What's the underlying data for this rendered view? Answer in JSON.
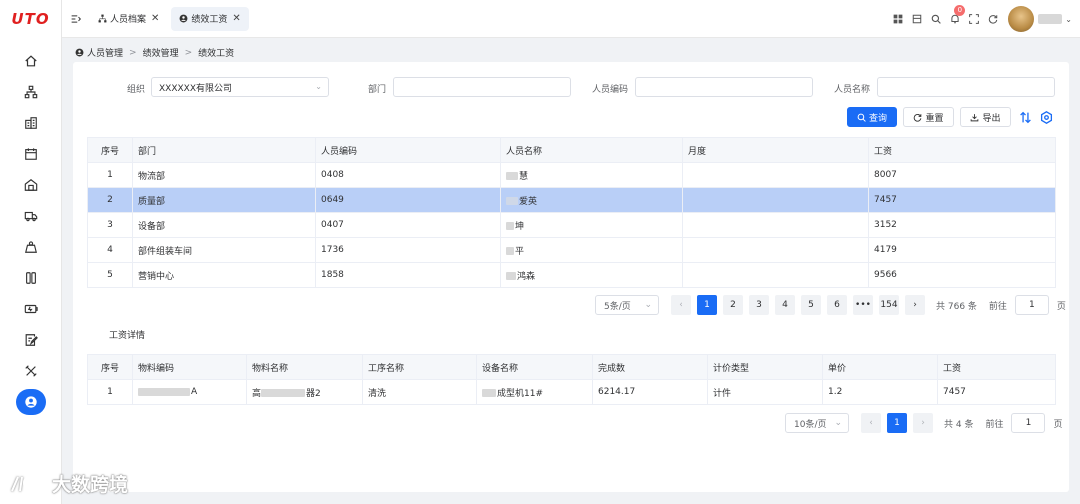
{
  "app": {
    "logo": "UTO"
  },
  "sidebar": {
    "items": [
      {
        "icon": "home-icon"
      },
      {
        "icon": "org-chart-icon"
      },
      {
        "icon": "building-icon"
      },
      {
        "icon": "calendar-icon"
      },
      {
        "icon": "warehouse-icon"
      },
      {
        "icon": "truck-icon"
      },
      {
        "icon": "weight-icon"
      },
      {
        "icon": "columns-icon"
      },
      {
        "icon": "battery-icon"
      },
      {
        "icon": "edit-doc-icon"
      },
      {
        "icon": "tools-icon"
      },
      {
        "icon": "user-circle-icon",
        "active": true
      }
    ],
    "active_color": "#1a6cf5"
  },
  "tabs": [
    {
      "label": "人员档案",
      "close": "✕"
    },
    {
      "label": "绩效工资",
      "close": "✕",
      "active": true
    }
  ],
  "header": {
    "notification_count": "0",
    "caret": "⌄"
  },
  "breadcrumb": [
    "人员管理",
    "绩效管理",
    "绩效工资"
  ],
  "breadcrumb_sep": ">",
  "filters": {
    "org_label": "组织",
    "org_value": "XXXXXX有限公司",
    "dept_label": "部门",
    "dept_value": "",
    "code_label": "人员编码",
    "code_value": "",
    "name_label": "人员名称",
    "name_value": ""
  },
  "actions": {
    "query": "查询",
    "reset": "重置",
    "export": "导出"
  },
  "main_table": {
    "columns": [
      "序号",
      "部门",
      "人员编码",
      "人员名称",
      "月度",
      "工资"
    ],
    "rows": [
      {
        "no": "1",
        "dept": "物流部",
        "code": "0408",
        "name": "慧",
        "month": "",
        "salary": "8007"
      },
      {
        "no": "2",
        "dept": "质量部",
        "code": "0649",
        "name": "爱英",
        "month": "",
        "salary": "7457",
        "selected": true
      },
      {
        "no": "3",
        "dept": "设备部",
        "code": "0407",
        "name": "坤",
        "month": "",
        "salary": "3152"
      },
      {
        "no": "4",
        "dept": "部件组装车间",
        "code": "1736",
        "name": "平",
        "month": "",
        "salary": "4179"
      },
      {
        "no": "5",
        "dept": "营销中心",
        "code": "1858",
        "name": "鸿森",
        "month": "",
        "salary": "9566"
      }
    ]
  },
  "pagination": {
    "page_size": "5条/页",
    "prev": "‹",
    "pages": [
      "1",
      "2",
      "3",
      "4",
      "5",
      "6",
      "•••",
      "154"
    ],
    "current": "1",
    "next": "›",
    "total": "共 766 条",
    "goto_label": "前往",
    "goto_value": "1",
    "page_unit": "页"
  },
  "detail": {
    "title": "工资详情",
    "columns": [
      "序号",
      "物料编码",
      "物料名称",
      "工序名称",
      "设备名称",
      "完成数",
      "计价类型",
      "单价",
      "工资"
    ],
    "rows": [
      {
        "no": "1",
        "material_code": "A",
        "material_name_prefix": "高",
        "material_name": "器2",
        "process": "清洗",
        "equipment": "成型机11#",
        "completed": "6214.17",
        "pricing": "计件",
        "unit_price": "1.2",
        "salary": "7457"
      }
    ]
  },
  "detail_pagination": {
    "page_size": "10条/页",
    "prev": "‹",
    "current": "1",
    "next": "›",
    "total": "共 4 条",
    "goto_label": "前往",
    "goto_value": "1",
    "page_unit": "页"
  },
  "watermark": {
    "text": "大数跨境"
  }
}
